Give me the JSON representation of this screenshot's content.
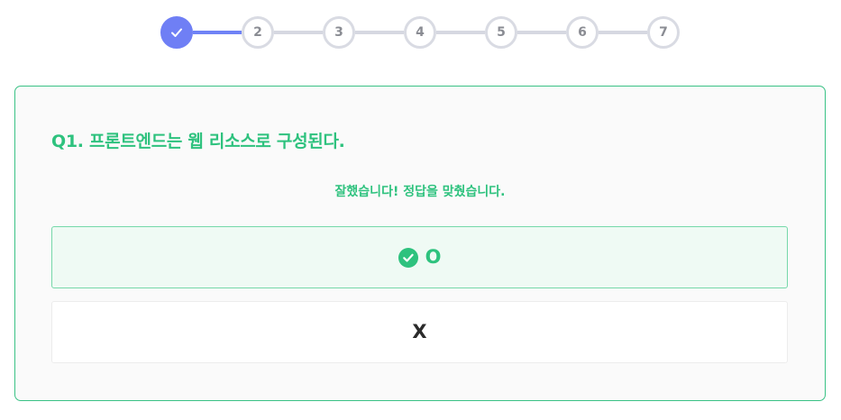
{
  "stepper": {
    "steps": [
      {
        "label": "",
        "state": "done"
      },
      {
        "label": "2",
        "state": "pending"
      },
      {
        "label": "3",
        "state": "pending"
      },
      {
        "label": "4",
        "state": "pending"
      },
      {
        "label": "5",
        "state": "pending"
      },
      {
        "label": "6",
        "state": "pending"
      },
      {
        "label": "7",
        "state": "pending"
      }
    ],
    "done_icon": "check-icon"
  },
  "quiz": {
    "question": "Q1. 프론트엔드는 웹 리소스로 구성된다.",
    "feedback": "잘했습니다! 정답을 맞췄습니다.",
    "options": [
      {
        "label": "O",
        "state": "correct",
        "icon": "check-circle-icon"
      },
      {
        "label": "X",
        "state": "default"
      }
    ]
  },
  "colors": {
    "accent": "#6f7ff5",
    "success": "#2ec27e",
    "inactive": "#d9dbe3"
  }
}
